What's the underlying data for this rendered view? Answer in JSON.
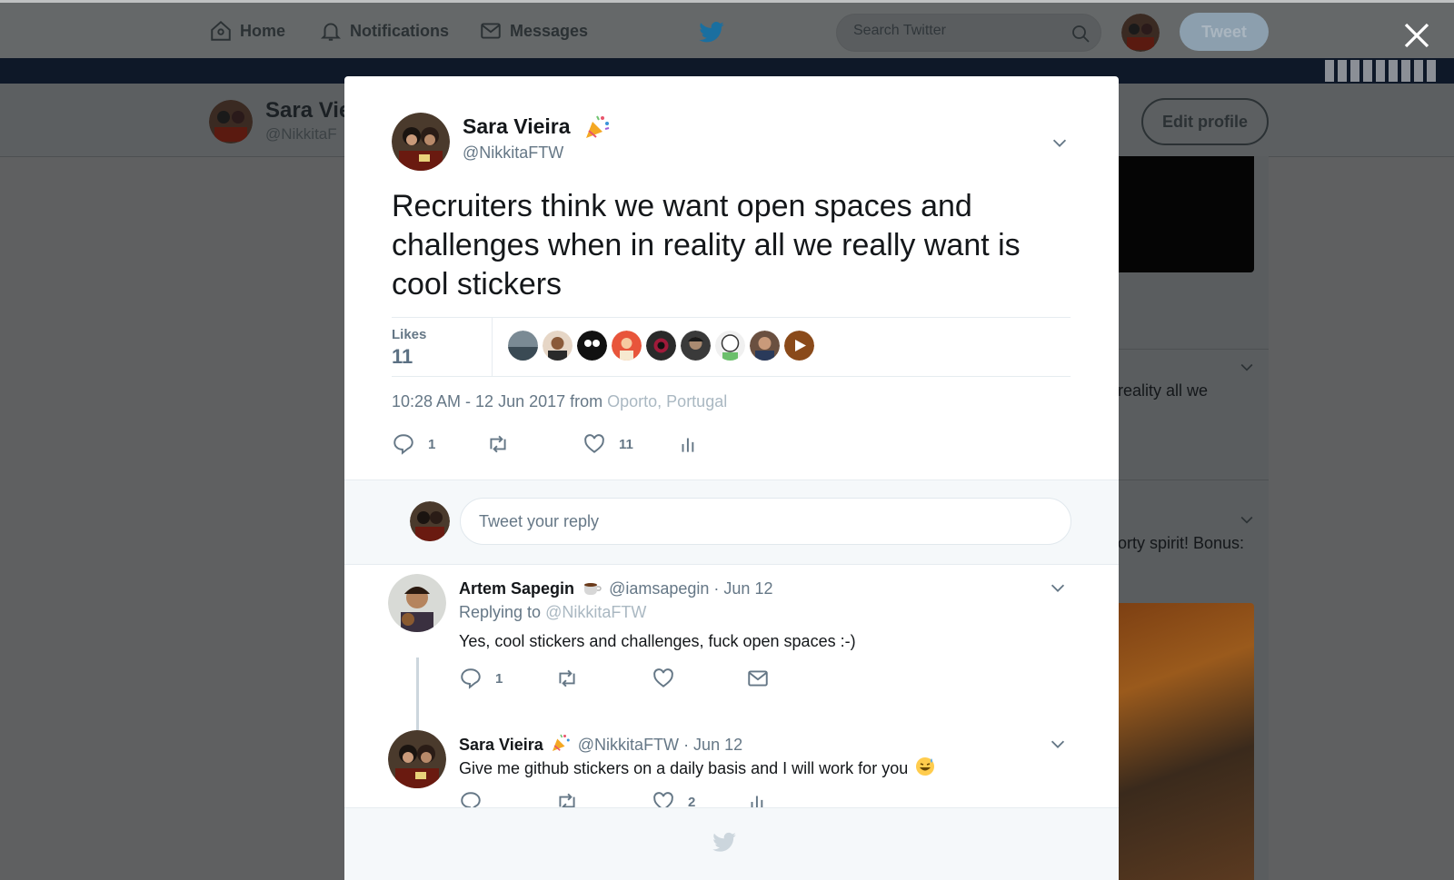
{
  "nav": {
    "home": "Home",
    "notifications": "Notifications",
    "messages": "Messages",
    "search_placeholder": "Search Twitter",
    "tweet_button": "Tweet"
  },
  "profile": {
    "name": "Sara Vie",
    "handle": "@NikkitaF",
    "edit_button": "Edit profile"
  },
  "background_tweets": {
    "snippet1": "reality all we",
    "snippet2": "orty spirit! Bonus:"
  },
  "tweet": {
    "author_name": "Sara Vieira",
    "author_handle": "@NikkitaFTW",
    "text": "Recruiters think we want open spaces and challenges when in reality all we really want is cool stickers",
    "likes_label": "Likes",
    "likes_count": "11",
    "time": "10:28 AM - 12 Jun 2017 from ",
    "location": "Oporto, Portugal",
    "reply_count": "1",
    "like_count": "11"
  },
  "reply_box": {
    "placeholder": "Tweet your reply"
  },
  "replies": [
    {
      "name": "Artem Sapegin",
      "handle": "@iamsapegin",
      "date": "· Jun 12",
      "replying_label": "Replying to ",
      "replying_to": "@NikkitaFTW",
      "text": "Yes, cool stickers and challenges, fuck open spaces :-)",
      "reply_count": "1"
    },
    {
      "name": "Sara Vieira",
      "handle": "@NikkitaFTW",
      "date": "· Jun 12",
      "text": "Give me github stickers on a daily basis and I will work for you",
      "like_count": "2"
    }
  ],
  "colors": {
    "accent": "#1da1f2",
    "muted": "#657786",
    "overlay": "#5f6061"
  }
}
